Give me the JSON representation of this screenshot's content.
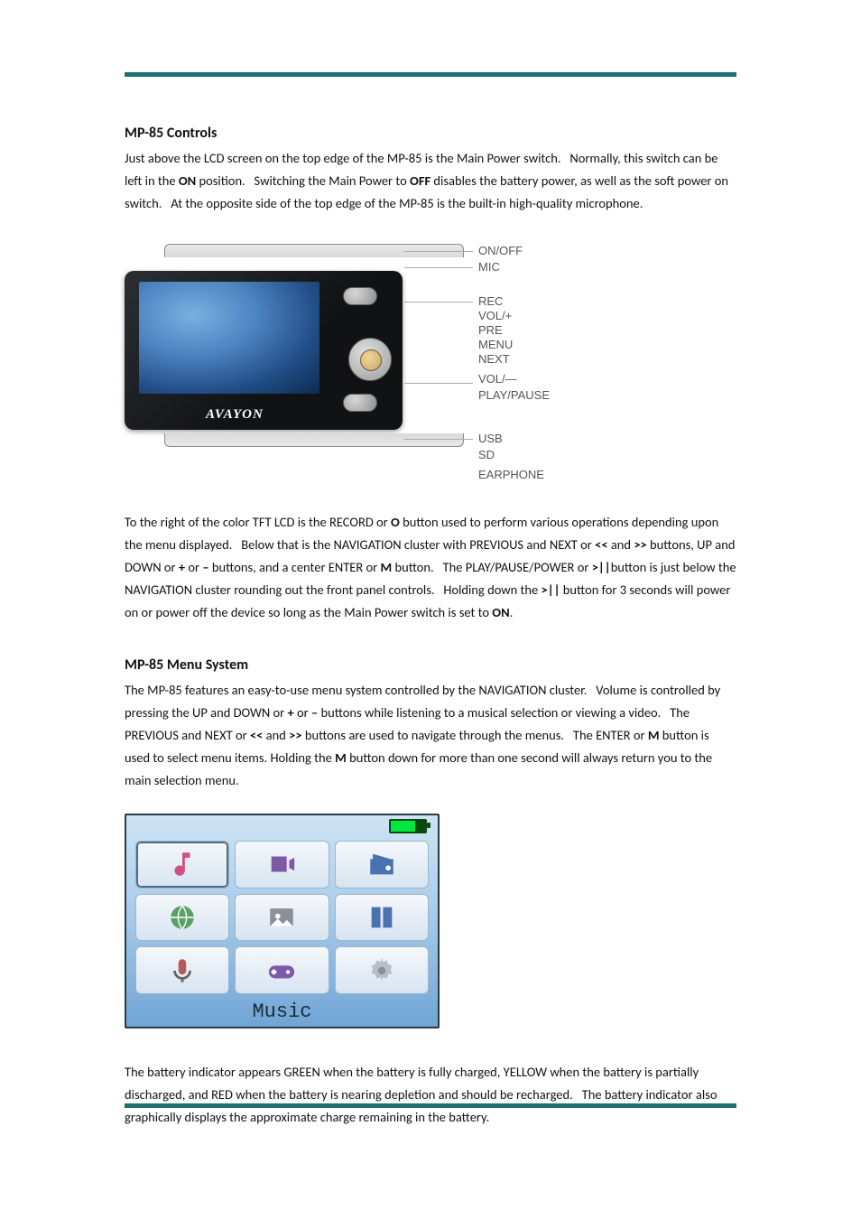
{
  "sections": {
    "controls": {
      "heading": "MP-85 Controls",
      "p1_pre": "Just above the LCD screen on the top edge of the MP-85 is the Main Power switch.   Normally, this switch can be left in the ",
      "p1_b1": "ON",
      "p1_mid1": " position.   Switching the Main Power to ",
      "p1_b2": "OFF",
      "p1_post": " disables the battery power, as well as the soft power on switch.   At the opposite side of the top edge of the MP-85 is the built-in high-quality microphone.",
      "p2_pre": "To the right of the color TFT LCD is the RECORD or ",
      "p2_b1": "O",
      "p2_m1": " button used to perform various operations depending upon the menu displayed.   Below that is the NAVIGATION cluster with PREVIOUS and NEXT or ",
      "p2_b2": "<<",
      "p2_m2": " and ",
      "p2_b3": ">>",
      "p2_m3": " buttons, UP and DOWN or ",
      "p2_b4": "+",
      "p2_m4": " or ",
      "p2_b5": "–",
      "p2_m5": " buttons, and a center ENTER or ",
      "p2_b6": "M",
      "p2_m6": " button.   The PLAY/PAUSE/POWER or ",
      "p2_b7": ">||",
      "p2_m7": "button is just below the NAVIGATION cluster rounding out the front panel controls.   Holding down the ",
      "p2_b8": ">||",
      "p2_m8": " button for 3 seconds will power on or power off the device so long as the Main Power switch is set to ",
      "p2_b9": "ON",
      "p2_end": "."
    },
    "menu": {
      "heading": "MP-85 Menu System",
      "p1_pre": "The MP-85 features an easy-to-use menu system controlled by the NAVIGATION cluster.   Volume is controlled by pressing the UP and DOWN or ",
      "p1_b1": "+",
      "p1_m1": " or ",
      "p1_b2": "–",
      "p1_m2": " buttons while listening to a musical selection or viewing a video.   The PREVIOUS and NEXT or ",
      "p1_b3": "<<",
      "p1_m3": " and ",
      "p1_b4": ">>",
      "p1_m4": " buttons are used to navigate through the menus.   The ENTER or ",
      "p1_b5": "M",
      "p1_m5": " button is used to select menu items. Holding the ",
      "p1_b6": "M",
      "p1_m6": " button down for more than one second will always return you to the main selection menu.",
      "p2": "The battery indicator appears GREEN when the battery is fully charged, YELLOW when the battery is partially discharged, and RED when the battery is nearing depletion and should be recharged.   The battery indicator also graphically displays the approximate charge remaining in the battery."
    }
  },
  "device": {
    "brand": "AVAYON",
    "callouts": {
      "onoff": "ON/OFF",
      "mic": "MIC",
      "rec": "REC",
      "volup": "VOL/+",
      "pre": "PRE",
      "menu": "MENU",
      "next": "NEXT",
      "voldn": "VOL/—",
      "play": "PLAY/PAUSE",
      "usb": "USB",
      "sd": "SD",
      "ear": "EARPHONE"
    }
  },
  "menu_screen": {
    "label": "Music"
  }
}
